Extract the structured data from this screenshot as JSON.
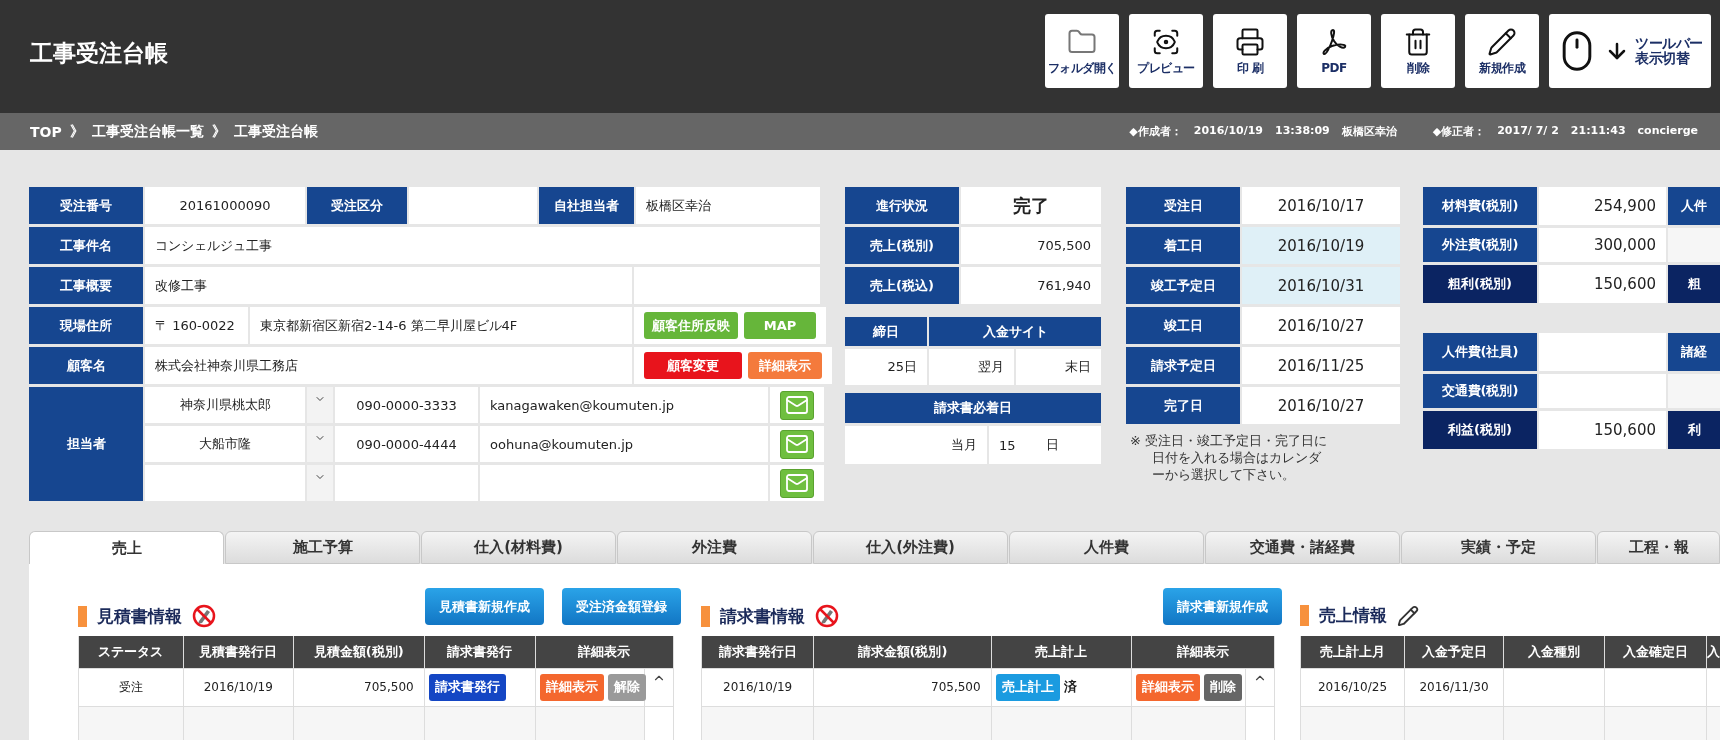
{
  "header": {
    "title": "工事受注台帳",
    "toolbar": [
      {
        "kind": "folder",
        "label": "フォルダ開く"
      },
      {
        "kind": "preview",
        "label": "プレビュー"
      },
      {
        "kind": "print",
        "label": "印 刷"
      },
      {
        "kind": "pdf",
        "label": "PDF"
      },
      {
        "kind": "delete",
        "label": "削除"
      },
      {
        "kind": "new",
        "label": "新規作成"
      },
      {
        "kind": "toggle",
        "label": "ツールバー表示切替"
      }
    ]
  },
  "breadcrumb": {
    "items": [
      "TOP",
      "工事受注台帳一覧",
      "工事受注台帳"
    ],
    "separator": "》",
    "meta": [
      {
        "label": "◆作成者：",
        "date": "2016/10/19",
        "time": "13:38:09",
        "user": "板橋区幸治"
      },
      {
        "label": "◆修正者：",
        "date": "2017/ 7/ 2",
        "time": "21:11:43",
        "user": "concierge"
      }
    ]
  },
  "order": {
    "first_row": [
      {
        "label": "受注番号",
        "value": "20161000090"
      },
      {
        "label": "受注区分"
      },
      {
        "label": "自社担当者",
        "value": "板橋区幸治"
      }
    ],
    "project_name": {
      "label": "工事件名",
      "value": "コンシェルジュ工事"
    },
    "summary": {
      "label": "工事概要",
      "value": "改修工事"
    },
    "site_address": {
      "label": "現場住所",
      "postal": "〒 160-0022",
      "address": "東京都新宿区新宿2-14-6 第二早川屋ビル4F",
      "buttons": [
        {
          "label": "顧客住所反映",
          "color": "#66b63a"
        },
        {
          "label": "MAP",
          "color": "#66b63a"
        }
      ]
    },
    "customer": {
      "label": "顧客名",
      "value": "株式会社神奈川県工務店",
      "buttons": [
        {
          "label": "顧客変更",
          "color": "#e8141c"
        },
        {
          "label": "詳細表示",
          "color": "#f47a3c"
        }
      ]
    },
    "contacts": {
      "label": "担当者",
      "rows": [
        {
          "name": "神奈川県桃太郎",
          "phone": "090-0000-3333",
          "email": "kanagawaken@koumuten.jp"
        },
        {
          "name": "大船市隆",
          "phone": "090-0000-4444",
          "email": "oohuna@koumuten.jp"
        },
        {}
      ]
    }
  },
  "progress": {
    "status": {
      "label": "進行状況",
      "value": "完了"
    },
    "amounts": [
      {
        "label": "売上(税別)",
        "value": "705,500"
      },
      {
        "label": "売上(税込)",
        "value": "761,940"
      }
    ],
    "closing": {
      "headers": [
        "締日",
        "入金サイト"
      ],
      "values": [
        "25日",
        "翌月",
        "末日"
      ]
    },
    "invoice_due": {
      "header": "請求書必着日",
      "values": [
        "当月",
        "15",
        "日"
      ]
    }
  },
  "dates": {
    "items": [
      {
        "label": "受注日",
        "value": "2016/10/17",
        "highlighted": false
      },
      {
        "label": "着工日",
        "value": "2016/10/19",
        "highlighted": true
      },
      {
        "label": "竣工予定日",
        "value": "2016/10/31",
        "highlighted": true
      },
      {
        "label": "竣工日",
        "value": "2016/10/27",
        "highlighted": false
      },
      {
        "label": "請求予定日",
        "value": "2016/11/25",
        "highlighted": false
      },
      {
        "label": "完了日",
        "value": "2016/10/27",
        "highlighted": false
      }
    ],
    "note": "※ 受注日・竣工予定日・完了日に日付を入れる場合はカレンダーから選択して下さい。"
  },
  "costs": [
    {
      "rows": [
        {
          "label": "材料費(税別)",
          "value": "254,900",
          "kind": "item"
        },
        {
          "label": "外注費(税別)",
          "value": "300,000",
          "kind": "item"
        },
        {
          "label": "粗利(税別)",
          "value": "150,600",
          "kind": "total"
        }
      ],
      "next_column": [
        {
          "label": "人件",
          "kind": "item"
        },
        {
          "kind": "blank"
        },
        {
          "label": "粗",
          "kind": "total"
        }
      ]
    },
    {
      "rows": [
        {
          "label": "人件費(社員)",
          "kind": "item"
        },
        {
          "label": "交通費(税別)",
          "kind": "item"
        },
        {
          "label": "利益(税別)",
          "value": "150,600",
          "kind": "total"
        }
      ],
      "next_column": [
        {
          "label": "諸経",
          "kind": "item"
        },
        {
          "kind": "blank"
        },
        {
          "label": "利",
          "kind": "total"
        }
      ]
    }
  ],
  "tabs": [
    {
      "label": "売上",
      "selected": true
    },
    {
      "label": "施工予算",
      "selected": false
    },
    {
      "label": "仕入(材料費)",
      "selected": false
    },
    {
      "label": "外注費",
      "selected": false
    },
    {
      "label": "仕入(外注費)",
      "selected": false
    },
    {
      "label": "人件費",
      "selected": false
    },
    {
      "label": "交通費・諸経費",
      "selected": false
    },
    {
      "label": "実績・予定",
      "selected": false
    },
    {
      "label": "工程・報",
      "selected": false
    }
  ],
  "sections": [
    {
      "title": "見積書情報",
      "kind": "locked",
      "scrollbar": true,
      "buttons": [
        "見積書新規作成",
        "受注済金額登録"
      ],
      "columns": [
        "ステータス",
        "見積書発行日",
        "見積金額(税別)",
        "請求書発行",
        "詳細表示"
      ],
      "rows": [
        {
          "cells": [
            {
              "kind": "text",
              "text": "受注"
            },
            {
              "kind": "text",
              "text": "2016/10/19"
            },
            {
              "kind": "amount",
              "text": "705,500"
            },
            {
              "kind": "buttons",
              "buttons": [
                {
                  "label": "請求書発行",
                  "color": "#1446c4"
                }
              ]
            },
            {
              "kind": "buttons",
              "buttons": [
                {
                  "label": "詳細表示",
                  "color": "#f4672e"
                },
                {
                  "label": "解除",
                  "color": "#9a9a9a"
                }
              ]
            }
          ]
        }
      ]
    },
    {
      "title": "請求書情報",
      "kind": "locked",
      "scrollbar": true,
      "buttons": [
        "請求書新規作成"
      ],
      "columns": [
        "請求書発行日",
        "請求金額(税別)",
        "売上計上",
        "詳細表示"
      ],
      "rows": [
        {
          "cells": [
            {
              "kind": "text",
              "text": "2016/10/19"
            },
            {
              "kind": "amount",
              "text": "705,500"
            },
            {
              "kind": "buttons",
              "buttons": [
                {
                  "label": "売上計上",
                  "color": "#1b9be0"
                }
              ],
              "note": "済"
            },
            {
              "kind": "buttons",
              "buttons": [
                {
                  "label": "詳細表示",
                  "color": "#f4672e"
                },
                {
                  "label": "削除",
                  "color": "#666666"
                }
              ]
            }
          ]
        }
      ]
    },
    {
      "title": "売上情報",
      "kind": "editable",
      "columns": [
        "売上計上月",
        "入金予定日",
        "入金種別",
        "入金確定日",
        "入"
      ],
      "rows": [
        {
          "cells": [
            {
              "kind": "text",
              "text": "2016/10/25"
            },
            {
              "kind": "text",
              "text": "2016/11/30"
            },
            {
              "kind": "text"
            },
            {
              "kind": "text"
            },
            {
              "kind": "text"
            }
          ]
        }
      ]
    }
  ]
}
